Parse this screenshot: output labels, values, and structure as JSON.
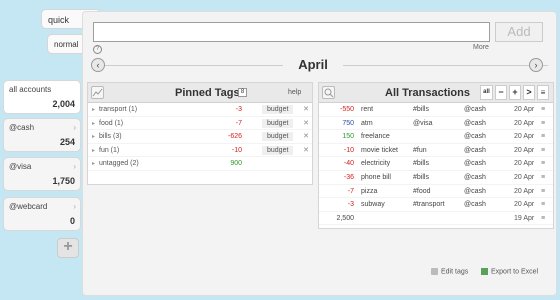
{
  "mode_tabs": {
    "quick": "quick",
    "normal": "normal"
  },
  "accounts": [
    {
      "name": "all accounts",
      "balance": "2,004"
    },
    {
      "name": "@cash",
      "balance": "254"
    },
    {
      "name": "@visa",
      "balance": "1,750"
    },
    {
      "name": "@webcard",
      "balance": "0"
    }
  ],
  "add_account_label": "+",
  "quick_entry": {
    "value": "",
    "placeholder": "",
    "add_label": "Add",
    "more_label": "More",
    "help_icon": "?"
  },
  "month": {
    "title": "April",
    "prev_icon": "‹",
    "next_icon": "›"
  },
  "pinned": {
    "title": "Pinned Tags",
    "count_icon": "8",
    "help_label": "help",
    "rows": [
      {
        "name": "transport (1)",
        "amount": "-3",
        "budget": "budget",
        "color": "neg"
      },
      {
        "name": "food (1)",
        "amount": "-7",
        "budget": "budget",
        "color": "neg"
      },
      {
        "name": "bills (3)",
        "amount": "-626",
        "budget": "budget",
        "color": "neg"
      },
      {
        "name": "fun (1)",
        "amount": "-10",
        "budget": "budget",
        "color": "neg"
      },
      {
        "name": "untagged (2)",
        "amount": "900",
        "budget": "",
        "color": "pos"
      }
    ]
  },
  "transactions": {
    "title": "All Transactions",
    "buttons": {
      "all": "all",
      "minus": "−",
      "plus": "+",
      "next": ">",
      "menu": "≡"
    },
    "rows": [
      {
        "amount": "-550",
        "desc": "rent",
        "tag": "#bills",
        "account": "@cash",
        "date": "20 Apr",
        "color": "neg"
      },
      {
        "amount": "750",
        "desc": "atm",
        "tag": "@visa",
        "account": "@cash",
        "date": "20 Apr",
        "color": "blue"
      },
      {
        "amount": "150",
        "desc": "freelance",
        "tag": "",
        "account": "@cash",
        "date": "20 Apr",
        "color": "pos"
      },
      {
        "amount": "-10",
        "desc": "movie ticket",
        "tag": "#fun",
        "account": "@cash",
        "date": "20 Apr",
        "color": "neg"
      },
      {
        "amount": "-40",
        "desc": "electricity",
        "tag": "#bills",
        "account": "@cash",
        "date": "20 Apr",
        "color": "neg"
      },
      {
        "amount": "-36",
        "desc": "phone bill",
        "tag": "#bills",
        "account": "@cash",
        "date": "20 Apr",
        "color": "neg"
      },
      {
        "amount": "-7",
        "desc": "pizza",
        "tag": "#food",
        "account": "@cash",
        "date": "20 Apr",
        "color": "neg"
      },
      {
        "amount": "-3",
        "desc": "subway",
        "tag": "#transport",
        "account": "@cash",
        "date": "20 Apr",
        "color": "neg"
      },
      {
        "amount": "2,500",
        "desc": "",
        "tag": "",
        "account": "",
        "date": "19 Apr",
        "color": "neu"
      }
    ]
  },
  "footer": {
    "edit_tags": "Edit tags",
    "export_excel": "Export to Excel"
  },
  "colors": {
    "negative": "#d32020",
    "positive": "#2f9b2f",
    "transfer": "#2a4fa8",
    "background": "#c5e6f3"
  }
}
